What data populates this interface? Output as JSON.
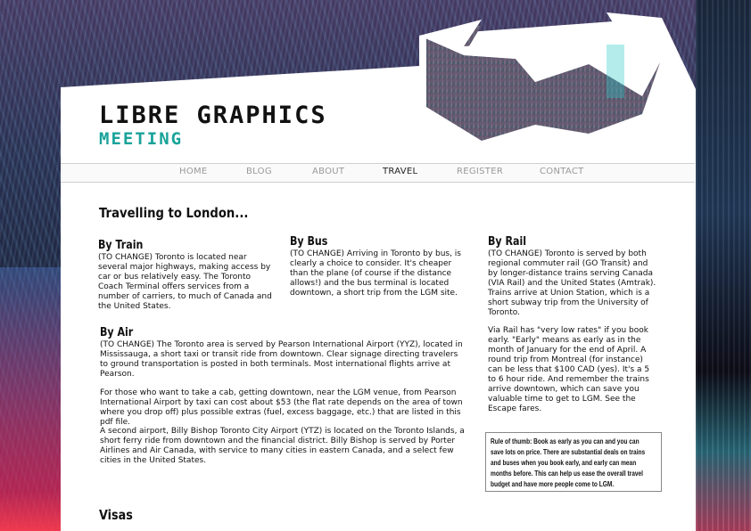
{
  "logo": {
    "line1": "LIBRE GRAPHICS",
    "line2": "MEETING"
  },
  "nav": {
    "items": [
      {
        "label": "HOME",
        "active": false
      },
      {
        "label": "BLOG",
        "active": false
      },
      {
        "label": "ABOUT",
        "active": false
      },
      {
        "label": "TRAVEL",
        "active": true
      },
      {
        "label": "REGISTER",
        "active": false
      },
      {
        "label": "CONTACT",
        "active": false
      }
    ]
  },
  "page": {
    "title": "Travelling to London...",
    "train": {
      "heading": "By Train",
      "body": "(TO CHANGE) Toronto is located near several major highways, making access by car or bus relatively easy. The Toronto Coach Terminal offers services from a number of carriers, to much of Canada and the United States."
    },
    "bus": {
      "heading": "By Bus",
      "body": "(TO CHANGE) Arriving in Toronto by bus, is clearly a choice to consider. It's cheaper than the plane (of course if the distance allows!) and the bus terminal is located downtown, a short trip from the LGM site."
    },
    "rail": {
      "heading": "By Rail",
      "body1": "(TO CHANGE) Toronto is served by both regional commuter rail (GO Transit) and by longer-distance trains serving Canada (VIA Rail) and the United States (Amtrak). Trains arrive at Union Station, which is a short subway trip from the University of Toronto.",
      "body2": "Via Rail has \"very low rates\" if you book early. \"Early\" means as early as in the month of January for the end of April. A round trip from Montreal (for instance) can be less that $100 CAD (yes). It's a 5 to 6 hour ride. And remember the trains arrive downtown, which can save you valuable time to get to LGM. See the Escape fares."
    },
    "air": {
      "heading": "By Air",
      "body1": "(TO CHANGE) The Toronto area is served by Pearson International Airport (YYZ), located in Mississauga, a short taxi or transit ride from downtown. Clear signage directing travelers to ground transportation is posted in both terminals. Most international flights arrive at Pearson.",
      "body2": "For those who want to take a cab, getting downtown, near the LGM venue, from Pearson International Airport by taxi can cost about $53 (the flat rate depends on the area of town where you drop off) plus possible extras (fuel, excess baggage, etc.) that are listed in this pdf file.",
      "body3": "A second airport, Billy Bishop Toronto City Airport (YTZ) is located on the Toronto Islands, a short ferry ride from downtown and the financial district. Billy Bishop is served by Porter Airlines and Air Canada, with service to many cities in eastern Canada, and a select few cities in the United States."
    },
    "note": "Rule of thumb: Book as early as you can and you can save lots on price. There are substantial deals on trains and buses when you book early, and early can mean months before. This can help us ease the overall travel budget and have more people come to LGM.",
    "visas": "Visas"
  },
  "colors": {
    "accent": "#19a39a",
    "text": "#111111",
    "nav_inactive": "#999999"
  }
}
